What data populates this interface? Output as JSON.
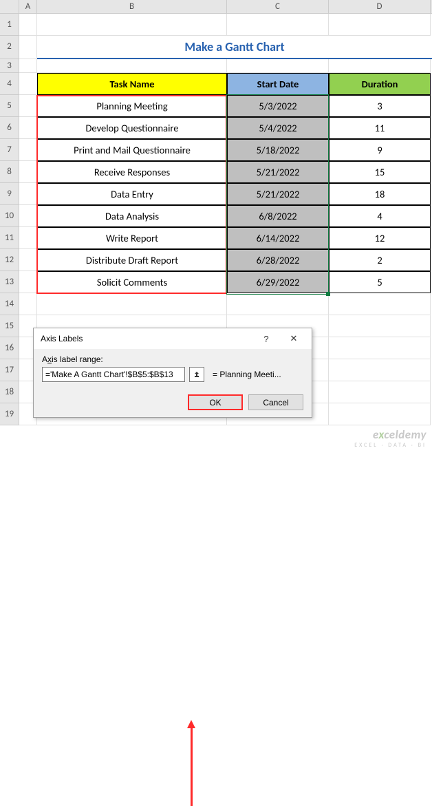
{
  "columns": [
    "A",
    "B",
    "C",
    "D"
  ],
  "row_numbers": [
    "1",
    "2",
    "3",
    "4",
    "5",
    "6",
    "7",
    "8",
    "9",
    "10",
    "11",
    "12",
    "13",
    "14",
    "15",
    "16",
    "17",
    "18",
    "19"
  ],
  "title": "Make a Gantt Chart",
  "headers": {
    "task": "Task Name",
    "start": "Start Date",
    "duration": "Duration"
  },
  "rows": [
    {
      "task": "Planning Meeting",
      "date": "5/3/2022",
      "dur": "3"
    },
    {
      "task": "Develop Questionnaire",
      "date": "5/4/2022",
      "dur": "11"
    },
    {
      "task": "Print and Mail Questionnaire",
      "date": "5/18/2022",
      "dur": "9"
    },
    {
      "task": "Receive Responses",
      "date": "5/21/2022",
      "dur": "15"
    },
    {
      "task": "Data Entry",
      "date": "5/21/2022",
      "dur": "18"
    },
    {
      "task": "Data Analysis",
      "date": "6/8/2022",
      "dur": "4"
    },
    {
      "task": "Write Report",
      "date": "6/14/2022",
      "dur": "12"
    },
    {
      "task": "Distribute Draft Report",
      "date": "6/28/2022",
      "dur": "2"
    },
    {
      "task": "Solicit Comments",
      "date": "6/29/2022",
      "dur": "5"
    }
  ],
  "dialog": {
    "title": "Axis Labels",
    "help": "?",
    "close": "✕",
    "label_pre": "A",
    "label_u": "x",
    "label_post": "is label range:",
    "input": "='Make A Gantt Chart'!$B$5:$B$13",
    "preview": "= Planning Meeti...",
    "ok": "OK",
    "cancel": "Cancel"
  },
  "watermark": {
    "main_pre": "e",
    "main_x": "x",
    "main_post": "celdemy",
    "sub": "EXCEL · DATA · BI"
  }
}
